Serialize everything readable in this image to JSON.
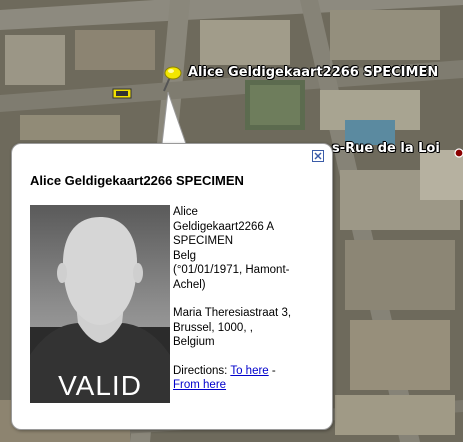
{
  "map": {
    "placemark_label": "Alice Geldigekaart2266 SPECIMEN",
    "street_label": "s-Rue de la Loi"
  },
  "popup": {
    "title": "Alice Geldigekaart2266 SPECIMEN",
    "photo_caption": "VALID",
    "name_line_1": "Alice",
    "name_line_2": "Geldigekaart2266 A",
    "name_line_3": "SPECIMEN",
    "nationality": "Belg",
    "birth_line_1": "(°01/01/1971, Hamont-",
    "birth_line_2": "Achel)",
    "address_line_1": "Maria Theresiastraat 3,",
    "address_line_2": "Brussel, 1000, ,",
    "address_line_3": "Belgium",
    "directions_label": "Directions:",
    "to_here": "To here",
    "separator": "-",
    "from_here": "From here"
  },
  "colors": {
    "link": "#0000cc",
    "pin": "#f2e600"
  }
}
